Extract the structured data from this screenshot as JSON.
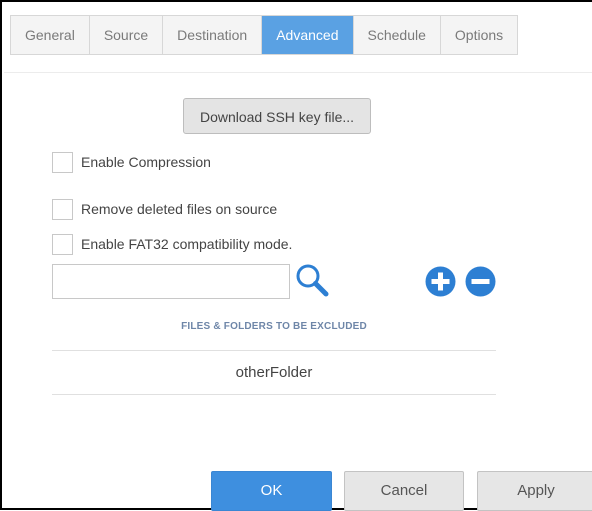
{
  "tabs": [
    {
      "label": "General",
      "active": false
    },
    {
      "label": "Source",
      "active": false
    },
    {
      "label": "Destination",
      "active": false
    },
    {
      "label": "Advanced",
      "active": true
    },
    {
      "label": "Schedule",
      "active": false
    },
    {
      "label": "Options",
      "active": false
    }
  ],
  "advanced": {
    "ssh_button_label": "Download SSH key file...",
    "enable_compression": {
      "label": "Enable Compression",
      "checked": false
    },
    "remove_deleted": {
      "label": "Remove deleted files on source",
      "checked": false
    },
    "fat32_mode": {
      "label": "Enable FAT32 compatibility mode.",
      "checked": false
    },
    "exclude_input": {
      "value": "",
      "placeholder": ""
    },
    "exclude_title": "FILES & FOLDERS TO BE EXCLUDED",
    "excluded_items": [
      "otherFolder"
    ]
  },
  "footer": {
    "ok_label": "OK",
    "cancel_label": "Cancel",
    "apply_label": "Apply"
  },
  "icons": {
    "search": "search-icon",
    "add": "plus-circle-icon",
    "remove": "minus-circle-icon"
  },
  "colors": {
    "accent": "#3e8fdf",
    "active_tab": "#5aa1e3",
    "icon_blue": "#2d7fd3",
    "section_title": "#6e86a8"
  }
}
